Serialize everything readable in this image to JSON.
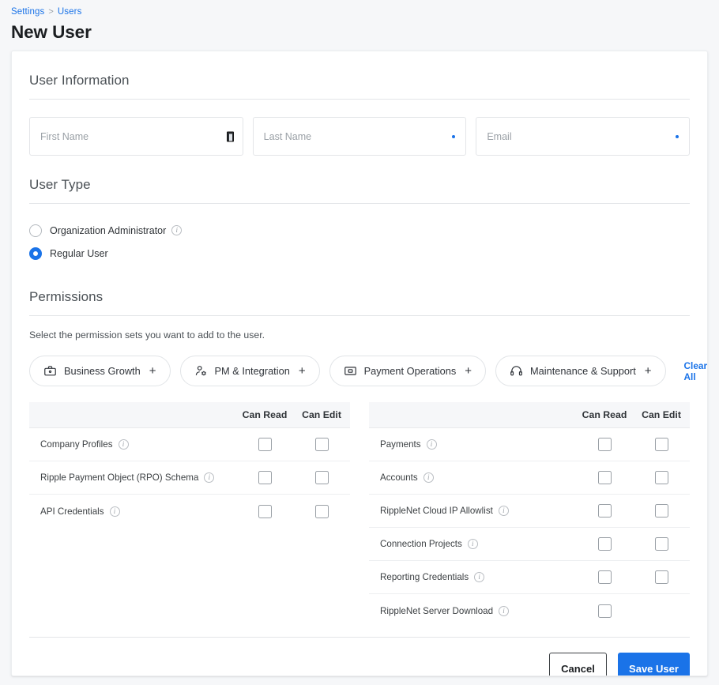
{
  "breadcrumb": {
    "root": "Settings",
    "separator": ">",
    "current": "Users"
  },
  "page_title": "New User",
  "sections": {
    "user_information": {
      "heading": "User Information",
      "fields": [
        {
          "name": "first-name",
          "placeholder": "First Name",
          "value": "",
          "marker": "text-cursor"
        },
        {
          "name": "last-name",
          "placeholder": "Last Name",
          "value": "",
          "marker": "required-dot"
        },
        {
          "name": "email",
          "placeholder": "Email",
          "value": "",
          "marker": "required-dot"
        }
      ]
    },
    "user_type": {
      "heading": "User Type",
      "options": [
        {
          "label": "Organization Administrator",
          "selected": false,
          "has_info": true
        },
        {
          "label": "Regular User",
          "selected": true,
          "has_info": false
        }
      ]
    },
    "permissions": {
      "heading": "Permissions",
      "description": "Select the permission sets you want to add to the user.",
      "chips": [
        {
          "label": "Business Growth",
          "icon": "briefcase-icon",
          "action": "+"
        },
        {
          "label": "PM & Integration",
          "icon": "person-gear-icon",
          "action": "+"
        },
        {
          "label": "Payment Operations",
          "icon": "banknote-icon",
          "action": "+"
        },
        {
          "label": "Maintenance & Support",
          "icon": "headset-icon",
          "action": "+"
        }
      ],
      "clear_all": "Clear All",
      "tables": [
        {
          "columns": [
            "",
            "Can Read",
            "Can Edit"
          ],
          "rows": [
            {
              "label": "Company Profiles",
              "has_info": true,
              "can_read": false,
              "can_edit": false,
              "edit_available": true
            },
            {
              "label": "Ripple Payment Object (RPO) Schema",
              "has_info": true,
              "can_read": false,
              "can_edit": false,
              "edit_available": true
            },
            {
              "label": "API Credentials",
              "has_info": true,
              "can_read": false,
              "can_edit": false,
              "edit_available": true
            }
          ]
        },
        {
          "columns": [
            "",
            "Can Read",
            "Can Edit"
          ],
          "rows": [
            {
              "label": "Payments",
              "has_info": true,
              "can_read": false,
              "can_edit": false,
              "edit_available": true
            },
            {
              "label": "Accounts",
              "has_info": true,
              "can_read": false,
              "can_edit": false,
              "edit_available": true
            },
            {
              "label": "RippleNet Cloud IP Allowlist",
              "has_info": true,
              "can_read": false,
              "can_edit": false,
              "edit_available": true
            },
            {
              "label": "Connection Projects",
              "has_info": true,
              "can_read": false,
              "can_edit": false,
              "edit_available": true
            },
            {
              "label": "Reporting Credentials",
              "has_info": true,
              "can_read": false,
              "can_edit": false,
              "edit_available": true
            },
            {
              "label": "RippleNet Server Download",
              "has_info": true,
              "can_read": false,
              "can_edit": false,
              "edit_available": false
            }
          ]
        }
      ]
    }
  },
  "footer": {
    "cancel_label": "Cancel",
    "save_label": "Save User"
  },
  "colors": {
    "accent": "#1a73e8",
    "page_bg": "#f6f7f9",
    "card_bg": "#ffffff",
    "border": "#e3e5e8",
    "text": "#3c4043",
    "muted": "#9aa0a6"
  }
}
